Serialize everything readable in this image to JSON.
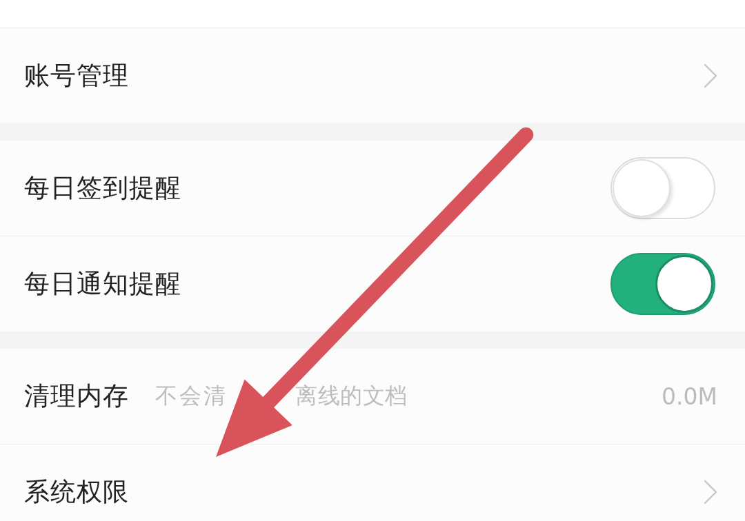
{
  "sections": [
    {
      "items": [
        {
          "kind": "link",
          "label": "账号管理"
        }
      ]
    },
    {
      "items": [
        {
          "kind": "toggle",
          "label": "每日签到提醒",
          "on": false
        },
        {
          "kind": "toggle",
          "label": "每日通知提醒",
          "on": true
        }
      ]
    },
    {
      "items": [
        {
          "kind": "info",
          "label": "清理内存",
          "hint_parts": [
            "不会清",
            "离线的文档"
          ],
          "value": "0.0M"
        },
        {
          "kind": "link",
          "label": "系统权限"
        }
      ]
    }
  ]
}
